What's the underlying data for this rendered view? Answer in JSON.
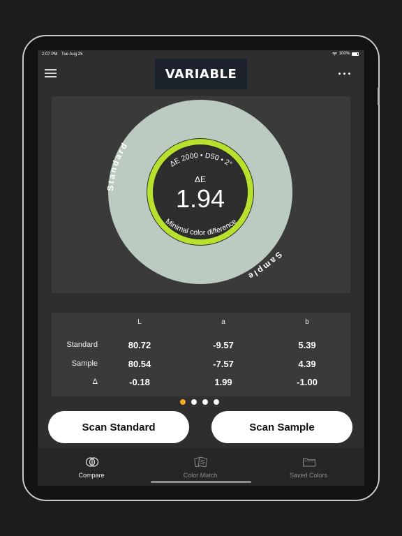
{
  "status": {
    "time": "2:07 PM",
    "date": "Tue Aug 25",
    "battery": "100%"
  },
  "header": {
    "logo": "VARIABLE",
    "menu_icon": "hamburger-icon",
    "more_icon": "more-dots-icon"
  },
  "gauge": {
    "standard_label": "Standard",
    "sample_label": "Sample",
    "method": "ΔE 2000 • D50 • 2°",
    "delta_symbol": "ΔE",
    "delta_value": "1.94",
    "description": "Minimal color difference",
    "colors": {
      "swatch": "#bccbc1",
      "ring": "#b8e12e",
      "center": "#2e2e2e"
    }
  },
  "table": {
    "headers": [
      "L",
      "a",
      "b"
    ],
    "rows": [
      {
        "label": "Standard",
        "values": [
          "80.72",
          "-9.57",
          "5.39"
        ]
      },
      {
        "label": "Sample",
        "values": [
          "80.54",
          "-7.57",
          "4.39"
        ]
      },
      {
        "label": "Δ",
        "values": [
          "-0.18",
          "1.99",
          "-1.00"
        ]
      }
    ]
  },
  "pager": {
    "count": 4,
    "active_index": 0,
    "active_color": "#f5a623"
  },
  "actions": {
    "scan_standard": "Scan Standard",
    "scan_sample": "Scan Sample"
  },
  "tabs": [
    {
      "label": "Compare",
      "icon": "compare-icon",
      "active": true
    },
    {
      "label": "Color Match",
      "icon": "color-cards-icon",
      "active": false
    },
    {
      "label": "Saved Colors",
      "icon": "folder-icon",
      "active": false
    }
  ]
}
